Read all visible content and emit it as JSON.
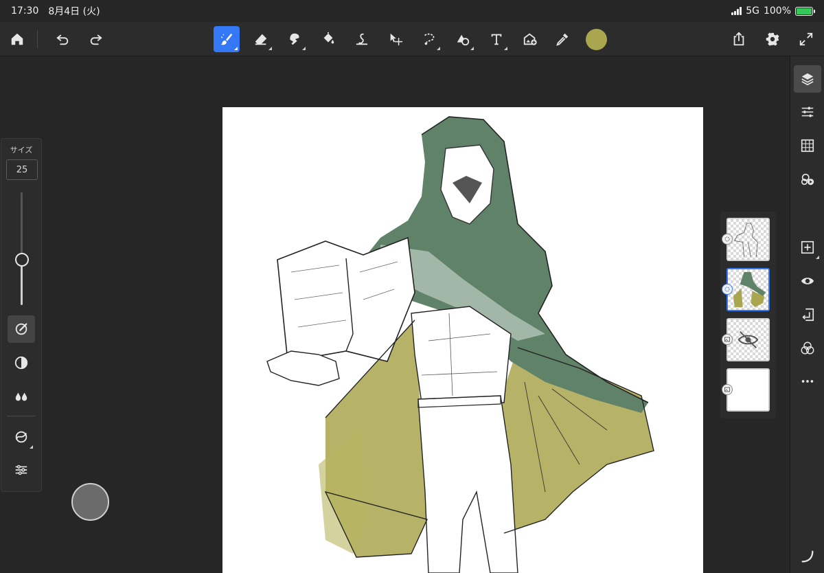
{
  "status_bar": {
    "time": "17:30",
    "date": "8月4日 (火)",
    "network": "5G",
    "battery": "100%"
  },
  "toolbar": {
    "left_icons": [
      "home-icon",
      "undo-icon",
      "redo-icon"
    ],
    "tools": [
      "brush-icon",
      "eraser-icon",
      "smudge-icon",
      "fill-icon",
      "liquify-icon",
      "transform-icon",
      "selection-icon",
      "shape-icon",
      "text-icon",
      "place-image-icon",
      "eyedropper-icon"
    ],
    "active_tool": "brush-icon",
    "current_color": "#a9a64f",
    "right_icons": [
      "share-icon",
      "settings-icon",
      "fullscreen-icon"
    ]
  },
  "brush_panel": {
    "size_label": "サイズ",
    "size_value": "25",
    "size_level": 0.4
  },
  "layers": {
    "count": 4,
    "selected_index": 1,
    "items": [
      {
        "type": "line-art",
        "badge": "brush-layer-icon"
      },
      {
        "type": "color",
        "badge": "brush-layer-icon"
      },
      {
        "type": "hidden",
        "badge": "image-layer-icon"
      },
      {
        "type": "background",
        "badge": "image-layer-icon"
      }
    ]
  },
  "right_sidebar": {
    "icons": [
      "layers-icon",
      "adjustments-icon",
      "grid-icon",
      "fx-icon",
      "add-layer-icon",
      "visibility-icon",
      "merge-down-icon",
      "blend-icon",
      "more-icon"
    ]
  },
  "colors": {
    "accent": "#3478f6",
    "cloak_green": "#5f8269",
    "cloak_olive": "#a9a64f"
  }
}
